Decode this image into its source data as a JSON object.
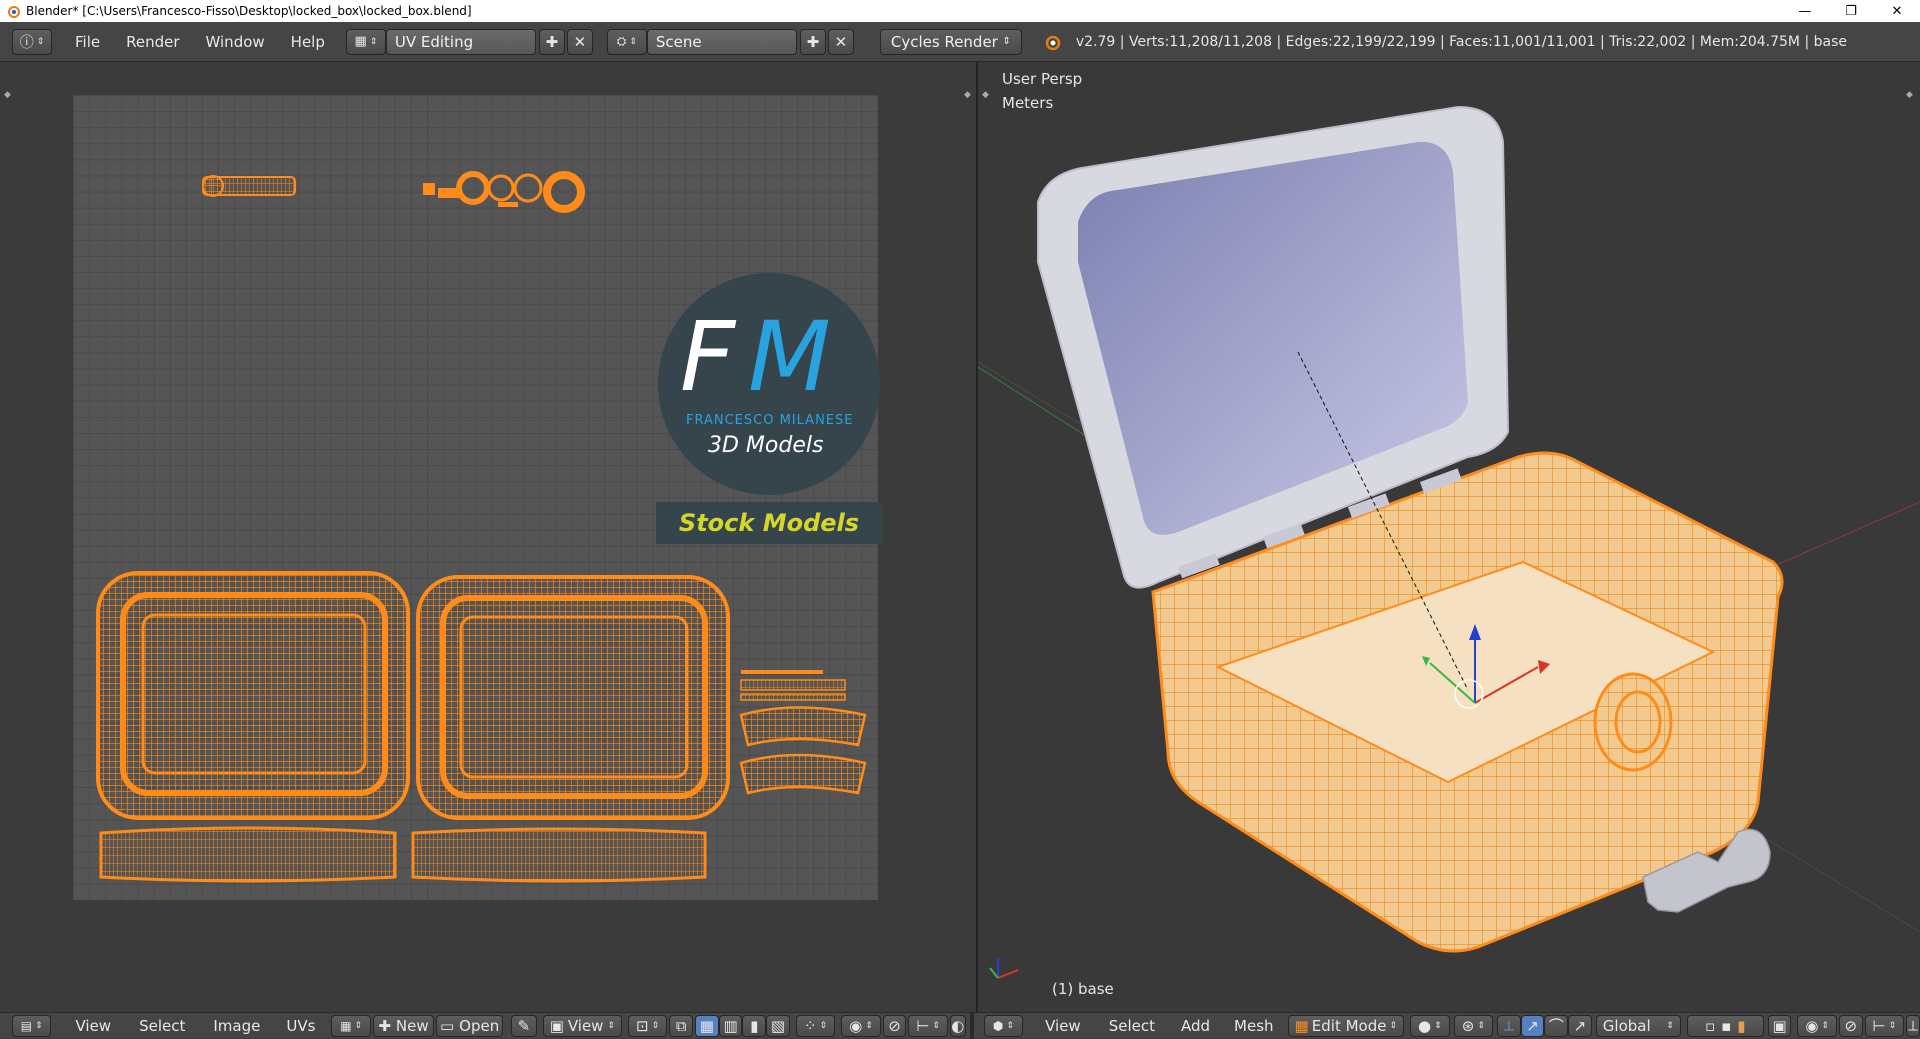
{
  "window": {
    "title": "Blender* [C:\\Users\\Francesco-Fisso\\Desktop\\locked_box\\locked_box.blend]",
    "minimize": "—",
    "restore": "❐",
    "close": "✕"
  },
  "topbar": {
    "menus": [
      "File",
      "Render",
      "Window",
      "Help"
    ],
    "screen_layout": "UV Editing",
    "scene": "Scene",
    "render_engine": "Cycles Render",
    "stats": "v2.79 | Verts:11,208/11,208 | Edges:22,199/22,199 | Faces:11,001/11,001 | Tris:22,002 | Mem:204.75M | base"
  },
  "uv_editor": {
    "logo": {
      "initials_f": "F",
      "initials_m": "M",
      "name": "FRANCESCO MILANESE",
      "tagline": "3D Models",
      "badge": "Stock Models"
    }
  },
  "viewport": {
    "view_name": "User Persp",
    "units": "Meters",
    "object_label": "(1) base"
  },
  "bottombar_left": {
    "menus": [
      "View",
      "Select",
      "Image",
      "UVs"
    ],
    "new_label": "New",
    "open_label": "Open",
    "view_dropdown": "View"
  },
  "bottombar_right": {
    "menus": [
      "View",
      "Select",
      "Add",
      "Mesh"
    ],
    "mode": "Edit Mode",
    "orientation": "Global"
  },
  "colors": {
    "accent_orange": "#ff8c1a",
    "logo_blue": "#29a3e0",
    "logo_yellow": "#d4d62a"
  }
}
